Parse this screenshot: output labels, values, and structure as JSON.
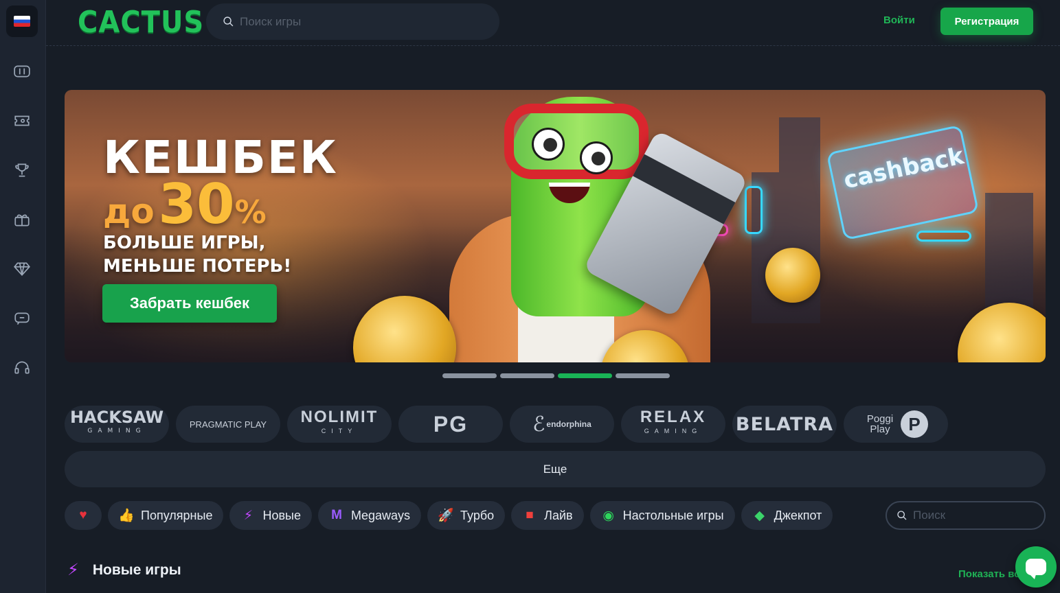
{
  "header": {
    "logo": "CACTUS",
    "search_placeholder": "Поиск игры",
    "login": "Войти",
    "register": "Регистрация"
  },
  "sidebar": {
    "items": [
      {
        "icon": "slots-icon"
      },
      {
        "icon": "ticket-icon"
      },
      {
        "icon": "trophy-icon"
      },
      {
        "icon": "gift-icon"
      },
      {
        "icon": "diamond-icon"
      },
      {
        "icon": "chat-icon"
      },
      {
        "icon": "support-headset-icon"
      }
    ]
  },
  "banner": {
    "title": "КЕШБЕК",
    "pct_prefix": "до",
    "pct_value": "30",
    "pct_sign": "%",
    "subtitle_line1": "БОЛЬШЕ ИГРЫ,",
    "subtitle_line2": "МЕНЬШЕ ПОТЕРЬ!",
    "cta": "Забрать кешбек",
    "card_text": "cashback",
    "slides": 4,
    "active_slide": 3
  },
  "providers": [
    {
      "name": "HACKSAW",
      "sub": "GAMING"
    },
    {
      "name": "PRAGMATIC PLAY"
    },
    {
      "name": "NOLIMIT",
      "sub": "CITY"
    },
    {
      "name": "PG"
    },
    {
      "name": "endorphina"
    },
    {
      "name": "RELAX",
      "sub": "GAMING"
    },
    {
      "name": "BELATRA"
    },
    {
      "name": "Poggi Play"
    }
  ],
  "more_label": "Еще",
  "categories": [
    {
      "label": "",
      "icon": "heart-icon",
      "color": "#e8323c"
    },
    {
      "label": "Популярные",
      "icon": "thumbs-up-icon",
      "color": "#f5c21b"
    },
    {
      "label": "Новые",
      "icon": "lightning-icon",
      "color": "#c347ff"
    },
    {
      "label": "Megaways",
      "icon": "megaways-icon",
      "color": "#9b5cff"
    },
    {
      "label": "Турбо",
      "icon": "rocket-icon",
      "color": "#2ed65c"
    },
    {
      "label": "Лайв",
      "icon": "live-camera-icon",
      "color": "#f0403c"
    },
    {
      "label": "Настольные игры",
      "icon": "table-games-icon",
      "color": "#2ed65c"
    },
    {
      "label": "Джекпот",
      "icon": "gem-icon",
      "color": "#3bd46a"
    }
  ],
  "category_search_placeholder": "Поиск",
  "section": {
    "title": "Новые игры",
    "show_all": "Показать все"
  }
}
